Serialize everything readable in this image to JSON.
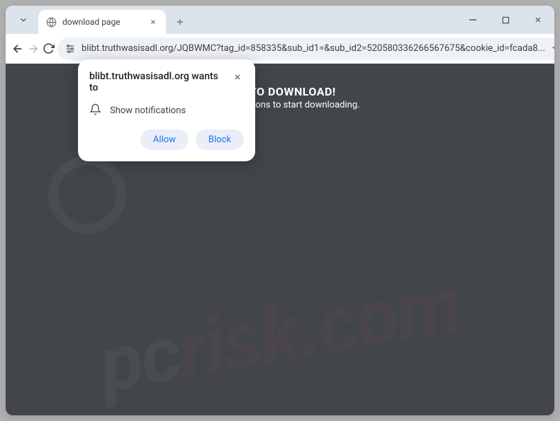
{
  "tab": {
    "title": "download page"
  },
  "omnibox": {
    "url_display": "blibt.truthwasisadl.org/JQBWMC?tag_id=858335&sub_id1=&sub_id2=520580336266567675&cookie_id=fcada8..."
  },
  "page": {
    "heading_visible": "ARE TO DOWNLOAD!",
    "subtext_visible": "yser notifications to start downloading."
  },
  "permission_prompt": {
    "origin": "blibt.truthwasisadl.org",
    "title_suffix": "wants to",
    "permission_label": "Show notifications",
    "allow_label": "Allow",
    "block_label": "Block"
  },
  "watermark": {
    "part1": "pc",
    "part2": "risk.com"
  }
}
